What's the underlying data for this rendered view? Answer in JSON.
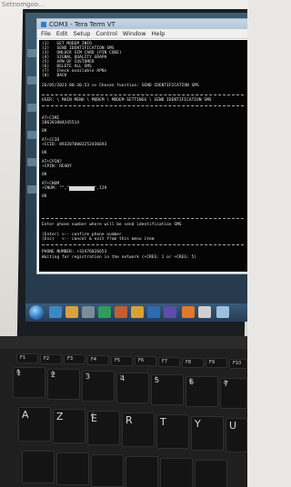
{
  "caption": "Setnomgoo...",
  "window": {
    "title": "COM3 - Tera Term VT",
    "menu": [
      "File",
      "Edit",
      "Setup",
      "Control",
      "Window",
      "Help"
    ]
  },
  "terminal": {
    "menu_lines": [
      "(1)   GET MODEM INFO",
      "(2)   SEND IDENTIFICATION SMS",
      "(3)   UNLOCK SIM CARD (PIN CODE)",
      "(4)   SIGNAL QUALITY GRAPH",
      "(5)   APN OF CUSTOMER",
      "(6)   DELETE ALL SMS",
      "(7)   Check available APNs",
      "(0)   BACK"
    ],
    "chosen": "26/05/2023 00:30:53 >> Chosen function: SEND IDENTIFICATION SMS",
    "path": "USER: \\ MAIN MENU \\ MODEM \\ MODEM SETTINGS \\ SEND IDENTIFICATION SMS",
    "log_lines": [
      "AT+CIMI",
      "206201004245514",
      "OK",
      "AT+CCID",
      "+CCID: 8932070003252436693",
      "OK",
      "AT+CPIN?",
      "+CPIN: READY",
      "OK",
      "AT+CNUM",
      "+CNUM: \"\",\"",
      "\",129",
      "OK"
    ],
    "prompt_lines": [
      "Enter phone number where will be send identification SMS",
      "(Enter) <-- confirm phone number",
      "(Esc)   <-- cancel & exit from this menu item"
    ],
    "phone_line": "PHONE NUMBER: +32476026653",
    "waiting_line": "Waiting for registration in the network (+CREG: 1 or +CREG: 5)"
  },
  "keyboard": {
    "fn_keys": [
      "F1",
      "F2",
      "F3",
      "F4",
      "F5",
      "F6",
      "F7",
      "F8",
      "F9",
      "F10"
    ],
    "row1": [
      {
        "top": "1",
        "bottom": "&"
      },
      {
        "top": "2",
        "bottom": "é"
      },
      {
        "top": "3",
        "bottom": "\""
      },
      {
        "top": "4",
        "bottom": "'"
      },
      {
        "top": "5",
        "bottom": "("
      },
      {
        "top": "6",
        "bottom": "§"
      },
      {
        "top": "7",
        "bottom": "è"
      }
    ],
    "row2": [
      "A",
      "Z",
      "E",
      "R",
      "T",
      "Y",
      "U"
    ],
    "euro": "€"
  },
  "colors": {
    "terminal_bg": "#050505",
    "terminal_fg": "#e9e9e9",
    "titlebar": "#c9d7e6"
  }
}
